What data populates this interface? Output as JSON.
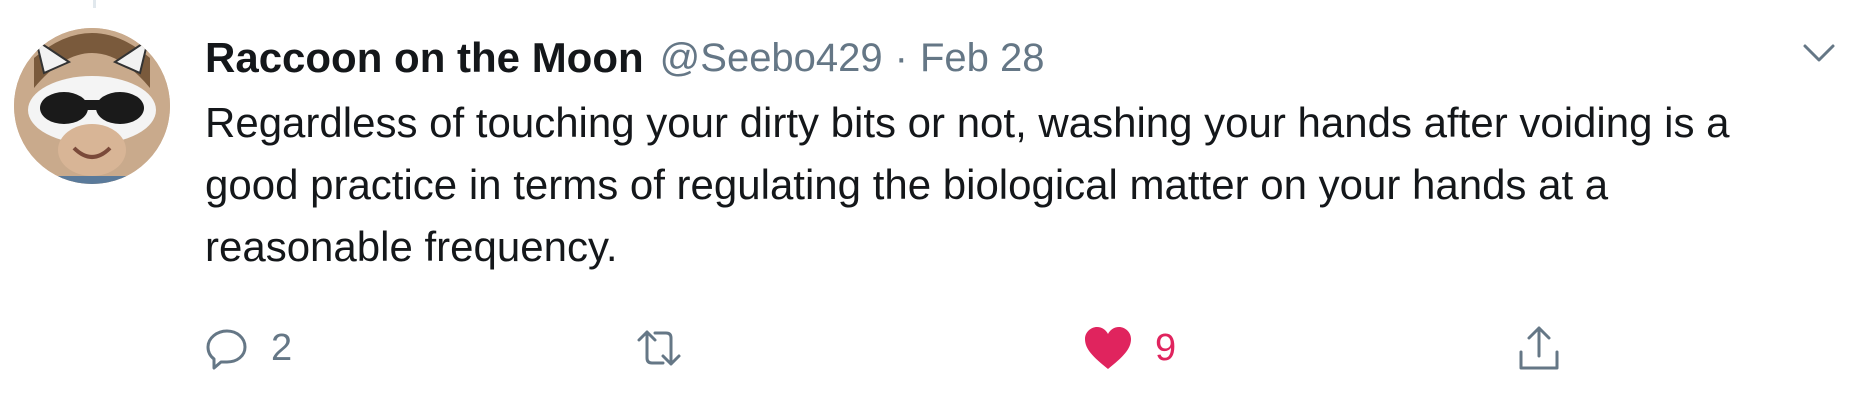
{
  "tweet": {
    "author_name": "Raccoon on the Moon",
    "handle": "@Seebo429",
    "separator": "·",
    "date": "Feb 28",
    "text": "Regardless of touching your dirty bits or not, washing your hands after voiding is a good practice in terms of regulating the biological matter on your hands at a reasonable frequency."
  },
  "actions": {
    "reply": {
      "icon": "reply-icon",
      "count": "2"
    },
    "retweet": {
      "icon": "retweet-icon",
      "count": ""
    },
    "like": {
      "icon": "heart-icon",
      "count": "9",
      "liked": true
    },
    "share": {
      "icon": "share-icon"
    }
  },
  "menu": {
    "icon": "chevron-down-icon"
  },
  "colors": {
    "text_primary": "#14171a",
    "text_secondary": "#657786",
    "like_active": "#e0245e"
  }
}
